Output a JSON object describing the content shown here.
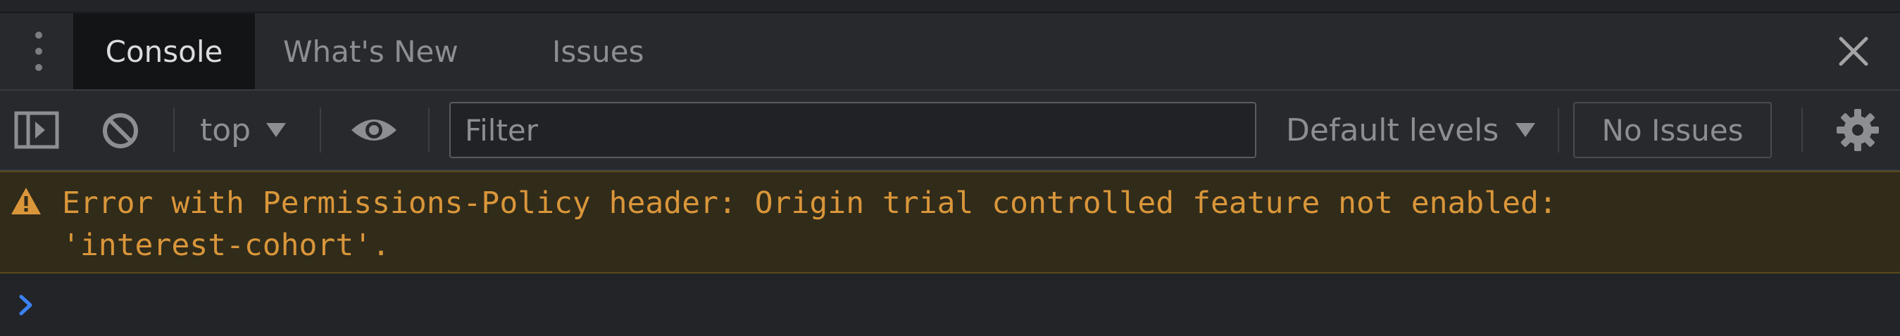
{
  "tabs": [
    {
      "label": "Console",
      "active": true
    },
    {
      "label": "What's New",
      "active": false
    },
    {
      "label": "Issues",
      "active": false
    }
  ],
  "toolbar": {
    "context": "top",
    "filter_placeholder": "Filter",
    "filter_value": "",
    "levels": "Default levels",
    "issues_label": "No Issues"
  },
  "messages": [
    {
      "level": "warning",
      "icon": "warning-icon",
      "text": "Error with Permissions-Policy header: Origin trial controlled feature not enabled:\n'interest-cohort'."
    }
  ],
  "prompt": {
    "icon": "chevron-right-icon"
  },
  "colors": {
    "background": "#232427",
    "toolbar": "#28292c",
    "active_tab": "#131416",
    "warning_bg": "#312b1a",
    "warning_text": "#d9963a",
    "prompt_accent": "#3b82f6"
  }
}
